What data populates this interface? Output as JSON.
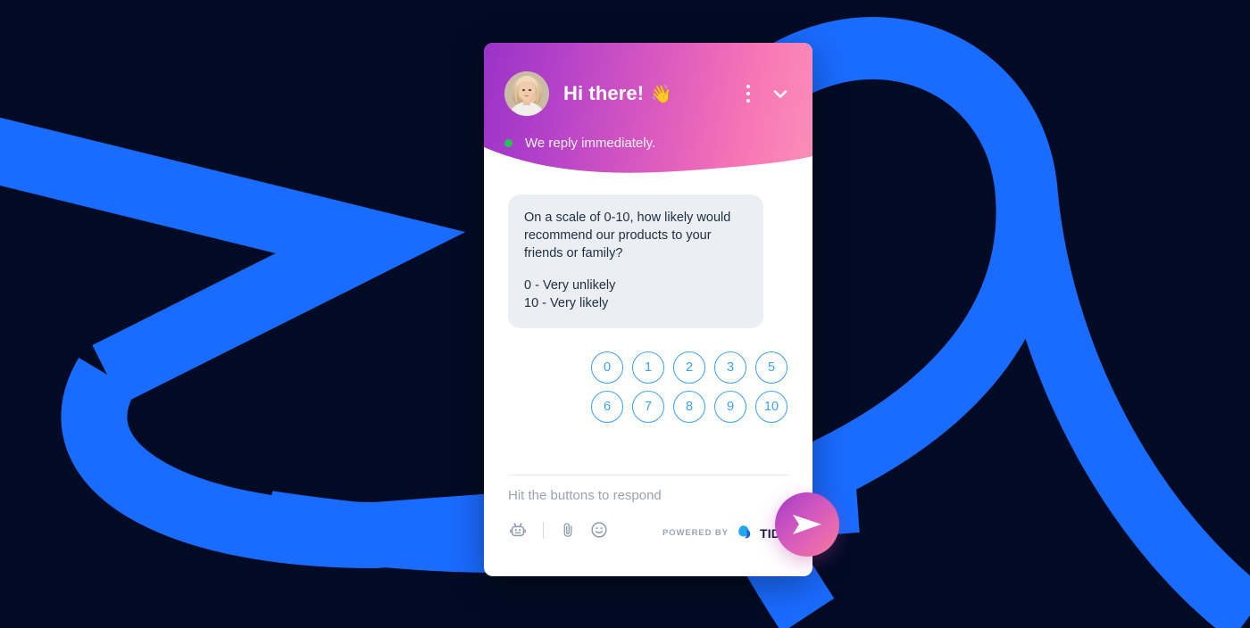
{
  "background": {
    "color": "#020B24",
    "ribbon_color": "#1A6BFF",
    "ribbon_name": "blue-ribbon-swirl"
  },
  "widget": {
    "header": {
      "title": "Hi there!",
      "title_emoji": "👋",
      "avatar_name": "agent-avatar-photo",
      "menu_icon": "kebab-menu-icon",
      "collapse_icon": "chevron-down-icon",
      "status_text": "We reply immediately.",
      "status_color": "#23C552",
      "gradient_from": "#9B32C8",
      "gradient_to": "#FB8FB9"
    },
    "message": {
      "question": "On a scale of 0-10, how likely would recommend our products to your friends or family?",
      "scale_low": "0 - Very unlikely",
      "scale_high": "10 - Very likely",
      "bubble_color": "#EBEFF3"
    },
    "choices": {
      "accent_color": "#3BA2F5",
      "rows": [
        [
          "0",
          "1",
          "2",
          "3",
          "5"
        ],
        [
          "6",
          "7",
          "8",
          "9",
          "10"
        ]
      ]
    },
    "composer": {
      "placeholder": "Hit the buttons to respond",
      "tools": [
        {
          "name": "bot-icon",
          "label": "Bot"
        },
        {
          "name": "attachment-paperclip-icon",
          "label": "Attach file"
        },
        {
          "name": "emoji-smiley-icon",
          "label": "Emoji"
        }
      ],
      "powered_by_label": "POWERED BY",
      "brand_name": "TIDIO",
      "brand_color": "#1A7CFF",
      "send_icon": "send-paper-plane-icon"
    }
  }
}
